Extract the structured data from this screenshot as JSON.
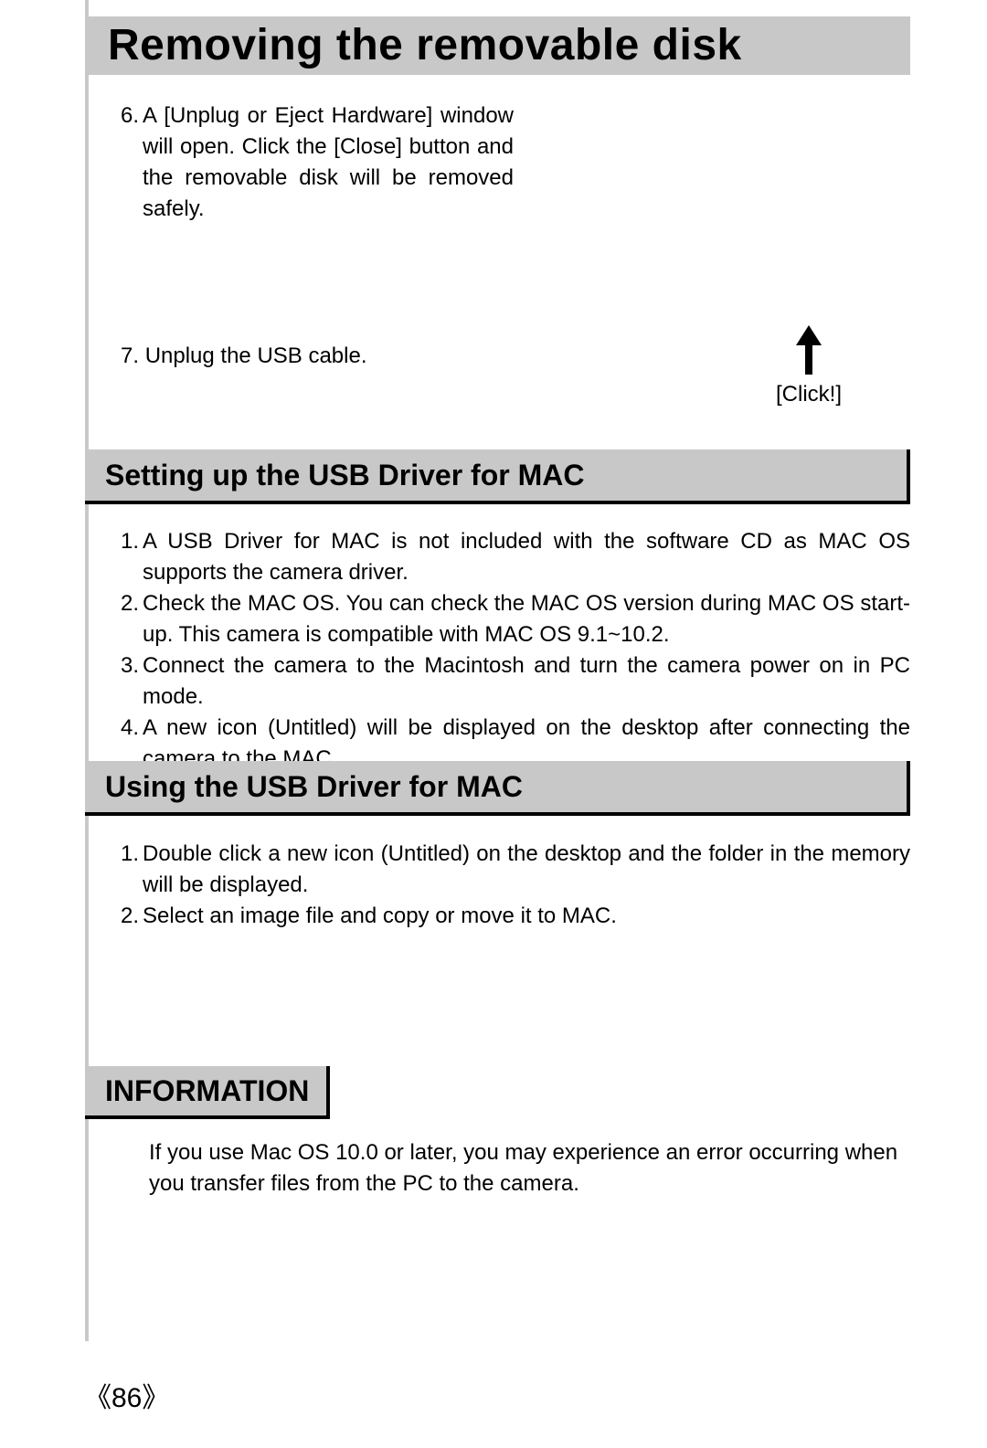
{
  "title": "Removing the removable disk",
  "step6_num": "6.",
  "step6_text": "A [Unplug or Eject Hardware] window will open. Click the [Close] button and the removable disk will be removed safely.",
  "step7_num": "7.",
  "step7_text": "Unplug the USB cable.",
  "click_label": "[Click!]",
  "sections": {
    "setup": {
      "title": "Setting up the USB Driver for MAC",
      "items": [
        {
          "num": "1.",
          "text": "A USB Driver for MAC is not included with the software CD as MAC OS supports the camera driver."
        },
        {
          "num": "2.",
          "text": "Check the MAC OS. You can check the MAC OS version during MAC OS start-up. This camera is compatible with MAC OS 9.1~10.2."
        },
        {
          "num": "3.",
          "text": "Connect the camera to the Macintosh and turn the camera power on in PC mode."
        },
        {
          "num": "4.",
          "text": "A new icon (Untitled) will be displayed on the desktop after connecting the camera to the MAC."
        }
      ]
    },
    "using": {
      "title": "Using the USB Driver for MAC",
      "items": [
        {
          "num": "1.",
          "text": "Double click a new icon (Untitled) on the desktop and the folder in the memory will be displayed."
        },
        {
          "num": "2.",
          "text": "Select an image file and copy or move it to MAC."
        }
      ]
    },
    "info": {
      "title": "INFORMATION",
      "text": "If you use Mac OS 10.0 or later, you may experience an error occurring when you transfer files from the PC to the camera."
    }
  },
  "page_number": "86"
}
